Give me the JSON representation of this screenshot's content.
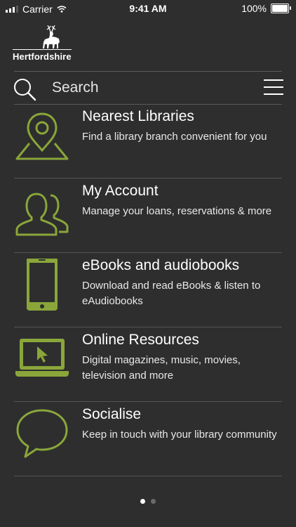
{
  "status_bar": {
    "carrier": "Carrier",
    "time": "9:41 AM",
    "battery": "100%",
    "battery_level": 1.0
  },
  "logo": {
    "wordmark": "Hertfordshire",
    "icon": "stag-icon"
  },
  "search": {
    "placeholder": "Search",
    "icon": "search-icon"
  },
  "menu_button": {
    "icon": "hamburger-menu-icon"
  },
  "accent_color": "#8aa63a",
  "menu_items": [
    {
      "title": "Nearest Libraries",
      "description": "Find a library branch convenient for you",
      "icon": "map-pin-icon"
    },
    {
      "title": "My Account",
      "description": "Manage your loans, reservations & more",
      "icon": "users-icon"
    },
    {
      "title": "eBooks and audiobooks",
      "description": "Download and read eBooks & listen to eAudiobooks",
      "icon": "tablet-icon"
    },
    {
      "title": "Online Resources",
      "description": "Digital magazines, music, movies, television and more",
      "icon": "laptop-icon"
    },
    {
      "title": "Socialise",
      "description": "Keep in touch with your library community",
      "icon": "speech-bubble-icon"
    }
  ],
  "pager": {
    "count": 2,
    "active": 1
  }
}
